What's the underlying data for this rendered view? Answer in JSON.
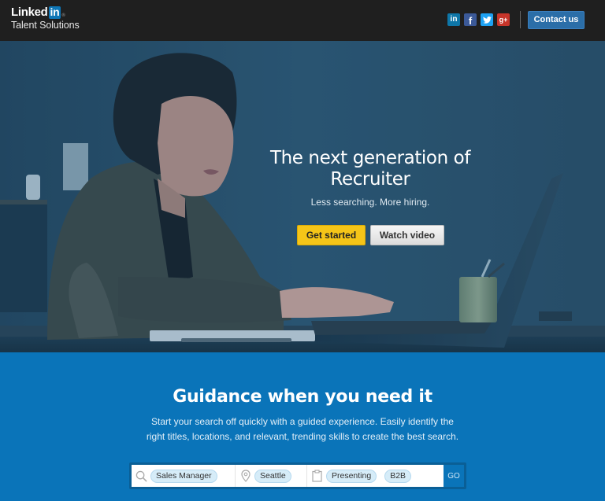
{
  "header": {
    "logo": {
      "word": "Linked",
      "badge": "in",
      "registered": "®",
      "subtitle": "Talent Solutions"
    },
    "social": [
      {
        "name": "linkedin",
        "glyph": "in",
        "color": "#0e76a8"
      },
      {
        "name": "facebook",
        "glyph": "f",
        "color": "#3b5998"
      },
      {
        "name": "twitter",
        "glyph": "t",
        "color": "#1da1f2"
      },
      {
        "name": "google-plus",
        "glyph": "g+",
        "color": "#c7352a"
      }
    ],
    "contact_label": "Contact us"
  },
  "hero": {
    "title": "The next generation of Recruiter",
    "subtitle": "Less searching. More hiring.",
    "primary_cta": "Get started",
    "secondary_cta": "Watch video",
    "accent_color": "#f5c518"
  },
  "guidance": {
    "title": "Guidance when you need it",
    "body": "Start your search off quickly with a guided experience. Easily identify the right titles, locations, and relevant, trending skills to create the best search.",
    "search": {
      "title_chip": "Sales Manager",
      "location_chip": "Seattle",
      "skill_chips": [
        "Presenting",
        "B2B"
      ],
      "go_label": "GO"
    },
    "background_color": "#0a74b9"
  }
}
